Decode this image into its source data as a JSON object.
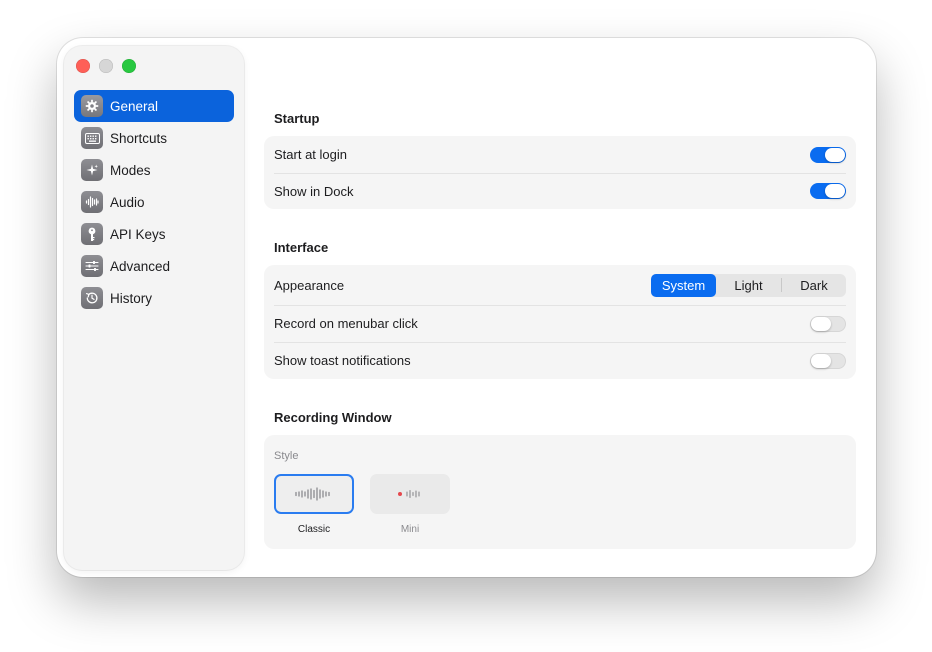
{
  "window": {
    "traffic_lights": {
      "close_color": "#fe5f57",
      "minimize_color": "#d6d6d6",
      "zoom_color": "#28c840"
    }
  },
  "sidebar": {
    "items": [
      {
        "label": "General",
        "icon": "gear-icon",
        "active": true
      },
      {
        "label": "Shortcuts",
        "icon": "keyboard-icon",
        "active": false
      },
      {
        "label": "Modes",
        "icon": "sparkle-icon",
        "active": false
      },
      {
        "label": "Audio",
        "icon": "waveform-icon",
        "active": false
      },
      {
        "label": "API Keys",
        "icon": "key-icon",
        "active": false
      },
      {
        "label": "Advanced",
        "icon": "sliders-icon",
        "active": false
      },
      {
        "label": "History",
        "icon": "clock-history-icon",
        "active": false
      }
    ]
  },
  "startup": {
    "title": "Startup",
    "start_at_login": {
      "label": "Start at login",
      "on": true
    },
    "show_in_dock": {
      "label": "Show in Dock",
      "on": true
    }
  },
  "interface": {
    "title": "Interface",
    "appearance": {
      "label": "Appearance",
      "options": [
        "System",
        "Light",
        "Dark"
      ],
      "selected": "System"
    },
    "record_on_menubar_click": {
      "label": "Record on menubar click",
      "on": false
    },
    "show_toast_notifications": {
      "label": "Show toast notifications",
      "on": false
    }
  },
  "recording_window": {
    "title": "Recording Window",
    "style_label": "Style",
    "options": [
      {
        "label": "Classic",
        "selected": true
      },
      {
        "label": "Mini",
        "selected": false
      }
    ]
  },
  "colors": {
    "accent": "#0a6cf0",
    "sidebar_active": "#0b63dc",
    "recording_dot": "#e5484d"
  }
}
